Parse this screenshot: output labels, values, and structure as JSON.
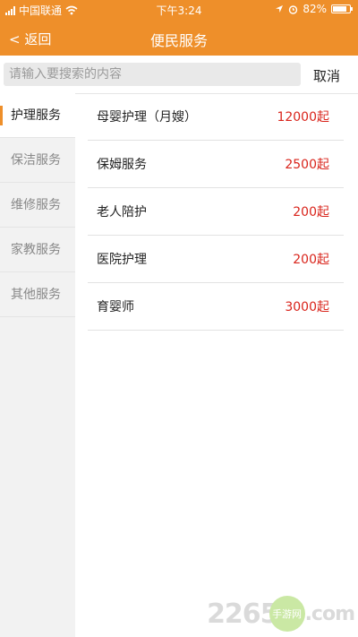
{
  "status_bar": {
    "carrier": "中国联通",
    "time": "下午3:24",
    "battery": "82%",
    "battery_level": 0.82
  },
  "nav": {
    "back_label": "< 返回",
    "title": "便民服务"
  },
  "search": {
    "placeholder": "请输入要搜索的内容",
    "value": "",
    "cancel_label": "取消"
  },
  "sidebar": {
    "items": [
      {
        "label": "护理服务",
        "active": true
      },
      {
        "label": "保洁服务",
        "active": false
      },
      {
        "label": "维修服务",
        "active": false
      },
      {
        "label": "家教服务",
        "active": false
      },
      {
        "label": "其他服务",
        "active": false
      }
    ]
  },
  "services": [
    {
      "name": "母婴护理（月嫂）",
      "price": "12000起"
    },
    {
      "name": "保姆服务",
      "price": "2500起"
    },
    {
      "name": "老人陪护",
      "price": "200起"
    },
    {
      "name": "医院护理",
      "price": "200起"
    },
    {
      "name": "育婴师",
      "price": "3000起"
    }
  ],
  "watermark": {
    "text": "2265",
    "suffix": ".com",
    "badge": "手游网"
  },
  "colors": {
    "accent": "#ee8f2a",
    "price": "#d9241b"
  }
}
